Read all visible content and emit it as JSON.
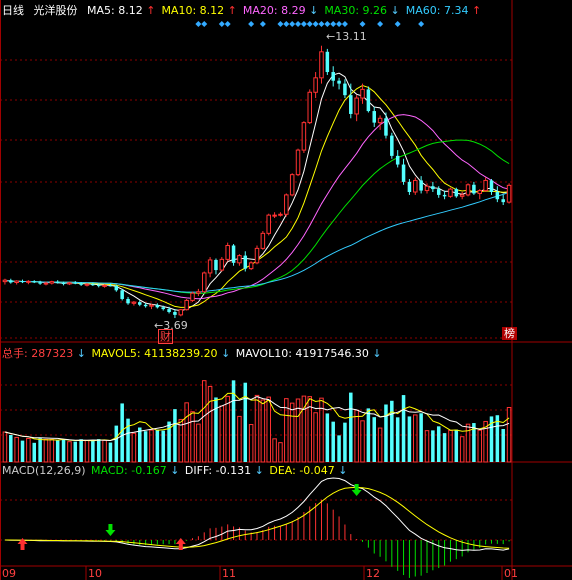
{
  "header": {
    "period": "日线",
    "stock_name": "光洋股份",
    "ma": [
      {
        "label": "MA5:",
        "value": "8.12",
        "arrow": "up",
        "color": "#ffffff"
      },
      {
        "label": "MA10:",
        "value": "8.12",
        "arrow": "up",
        "color": "#ffff00"
      },
      {
        "label": "MA20:",
        "value": "8.29",
        "arrow": "down",
        "color": "#ff66ff"
      },
      {
        "label": "MA30:",
        "value": "9.26",
        "arrow": "down",
        "color": "#00e000"
      },
      {
        "label": "MA60:",
        "value": "7.34",
        "arrow": "up",
        "color": "#33ccff"
      }
    ]
  },
  "volume_header": {
    "total_label": "总手:",
    "total_value": "287323",
    "vol5_label": "MAVOL5:",
    "vol5_value": "41138239.20",
    "vol10_label": "MAVOL10:",
    "vol10_value": "41917546.30"
  },
  "macd_header": {
    "name": "MACD(12,26,9)",
    "macd_label": "MACD:",
    "macd_value": "-0.167",
    "diff_label": "DIFF:",
    "diff_value": "-0.131",
    "dea_label": "DEA:",
    "dea_value": "-0.047"
  },
  "annotations": {
    "high_label": "13.11",
    "low_label": "3.69",
    "cai_tag": "财",
    "bang_tag": "榜"
  },
  "x_axis_labels": [
    "09",
    "10",
    "11",
    "12",
    "01"
  ],
  "colors": {
    "up": "#ff3232",
    "down": "#54ffff",
    "ma5": "#ffffff",
    "ma10": "#ffff00",
    "ma20": "#ff66ff",
    "ma30": "#00e000",
    "ma60": "#33ccff",
    "grid": "#8b0000",
    "axis_text": "#ff4040"
  },
  "chart_data": {
    "type": "candlestick",
    "period": "daily",
    "x_ticks": [
      "09",
      "10",
      "11",
      "12",
      "01"
    ],
    "price_range": [
      3.0,
      14.0
    ],
    "high_marker": 13.11,
    "low_marker": 3.69,
    "ohlc": [
      [
        4.95,
        5.05,
        4.85,
        5.0
      ],
      [
        5.0,
        5.05,
        4.88,
        4.92
      ],
      [
        4.92,
        5.0,
        4.85,
        4.97
      ],
      [
        4.97,
        5.02,
        4.9,
        4.93
      ],
      [
        4.93,
        5.0,
        4.86,
        4.96
      ],
      [
        4.96,
        5.0,
        4.9,
        4.92
      ],
      [
        4.92,
        4.98,
        4.84,
        4.88
      ],
      [
        4.88,
        4.95,
        4.82,
        4.9
      ],
      [
        4.9,
        4.98,
        4.85,
        4.95
      ],
      [
        4.95,
        5.0,
        4.88,
        4.9
      ],
      [
        4.9,
        4.95,
        4.82,
        4.87
      ],
      [
        4.87,
        4.94,
        4.83,
        4.91
      ],
      [
        4.91,
        4.97,
        4.86,
        4.89
      ],
      [
        4.89,
        4.93,
        4.8,
        4.84
      ],
      [
        4.84,
        4.9,
        4.78,
        4.86
      ],
      [
        4.86,
        4.92,
        4.8,
        4.83
      ],
      [
        4.83,
        4.88,
        4.75,
        4.8
      ],
      [
        4.8,
        4.86,
        4.74,
        4.82
      ],
      [
        4.82,
        4.88,
        4.78,
        4.8
      ],
      [
        4.8,
        4.84,
        4.6,
        4.65
      ],
      [
        4.65,
        4.7,
        4.3,
        4.35
      ],
      [
        4.35,
        4.42,
        4.15,
        4.2
      ],
      [
        4.2,
        4.28,
        4.12,
        4.24
      ],
      [
        4.24,
        4.3,
        4.1,
        4.15
      ],
      [
        4.15,
        4.22,
        4.05,
        4.1
      ],
      [
        4.1,
        4.18,
        4.0,
        4.14
      ],
      [
        4.14,
        4.2,
        4.02,
        4.06
      ],
      [
        4.06,
        4.12,
        3.95,
        4.0
      ],
      [
        4.0,
        4.08,
        3.85,
        3.9
      ],
      [
        3.9,
        4.0,
        3.69,
        3.8
      ],
      [
        3.8,
        4.0,
        3.75,
        3.98
      ],
      [
        3.98,
        4.35,
        3.95,
        4.3
      ],
      [
        4.3,
        4.6,
        4.25,
        4.55
      ],
      [
        4.55,
        4.7,
        4.45,
        4.6
      ],
      [
        4.6,
        5.3,
        4.6,
        5.25
      ],
      [
        5.25,
        5.8,
        5.1,
        5.7
      ],
      [
        5.7,
        5.75,
        5.2,
        5.35
      ],
      [
        5.35,
        5.8,
        5.3,
        5.72
      ],
      [
        5.72,
        6.3,
        5.65,
        6.2
      ],
      [
        6.2,
        6.25,
        5.5,
        5.6
      ],
      [
        5.6,
        5.9,
        5.5,
        5.85
      ],
      [
        5.85,
        6.0,
        5.3,
        5.4
      ],
      [
        5.4,
        5.65,
        5.35,
        5.6
      ],
      [
        5.6,
        6.2,
        5.55,
        6.1
      ],
      [
        6.1,
        6.7,
        6.05,
        6.62
      ],
      [
        6.62,
        7.3,
        6.55,
        7.25
      ],
      [
        7.25,
        7.35,
        7.15,
        7.25
      ],
      [
        7.25,
        7.35,
        7.2,
        7.28
      ],
      [
        7.28,
        8.0,
        7.2,
        7.95
      ],
      [
        7.95,
        8.7,
        7.9,
        8.65
      ],
      [
        8.65,
        9.55,
        8.6,
        9.5
      ],
      [
        9.5,
        10.5,
        9.4,
        10.45
      ],
      [
        10.45,
        11.6,
        10.4,
        11.5
      ],
      [
        11.5,
        12.2,
        11.3,
        12.0
      ],
      [
        12.0,
        13.11,
        11.8,
        12.9
      ],
      [
        12.9,
        13.0,
        12.1,
        12.2
      ],
      [
        12.2,
        12.4,
        11.7,
        11.9
      ],
      [
        11.9,
        12.0,
        11.6,
        11.8
      ],
      [
        11.8,
        11.95,
        11.3,
        11.4
      ],
      [
        11.4,
        11.8,
        10.6,
        10.75
      ],
      [
        10.75,
        11.4,
        10.5,
        11.3
      ],
      [
        11.3,
        11.8,
        11.1,
        11.6
      ],
      [
        11.6,
        11.7,
        10.8,
        10.85
      ],
      [
        10.85,
        11.0,
        10.3,
        10.45
      ],
      [
        10.45,
        10.7,
        10.2,
        10.6
      ],
      [
        10.6,
        10.8,
        9.9,
        10.0
      ],
      [
        10.0,
        10.1,
        9.2,
        9.3
      ],
      [
        9.3,
        9.5,
        8.9,
        9.0
      ],
      [
        9.0,
        9.2,
        8.3,
        8.4
      ],
      [
        8.4,
        8.5,
        7.95,
        8.05
      ],
      [
        8.05,
        8.55,
        7.95,
        8.45
      ],
      [
        8.45,
        8.6,
        8.0,
        8.1
      ],
      [
        8.1,
        8.35,
        8.0,
        8.25
      ],
      [
        8.25,
        8.4,
        8.05,
        8.15
      ],
      [
        8.15,
        8.25,
        7.85,
        7.95
      ],
      [
        7.95,
        8.1,
        7.8,
        7.9
      ],
      [
        7.9,
        8.2,
        7.85,
        8.15
      ],
      [
        8.15,
        8.2,
        7.85,
        7.9
      ],
      [
        7.9,
        8.05,
        7.8,
        7.95
      ],
      [
        7.95,
        8.35,
        7.9,
        8.3
      ],
      [
        8.3,
        8.4,
        7.95,
        8.0
      ],
      [
        8.0,
        8.15,
        7.8,
        8.1
      ],
      [
        8.1,
        8.55,
        8.05,
        8.45
      ],
      [
        8.45,
        8.5,
        7.95,
        8.05
      ],
      [
        8.05,
        8.25,
        7.7,
        7.8
      ],
      [
        7.8,
        7.95,
        7.6,
        7.7
      ],
      [
        7.7,
        8.35,
        7.65,
        8.28
      ]
    ],
    "ma_series": [
      {
        "name": "MA5",
        "last": 8.12
      },
      {
        "name": "MA10",
        "last": 8.12
      },
      {
        "name": "MA20",
        "last": 8.29
      },
      {
        "name": "MA30",
        "last": 9.26
      },
      {
        "name": "MA60",
        "last": 7.34
      }
    ],
    "volume": {
      "last_total": 287323,
      "mavol5": 41138239.2,
      "mavol10": 41917546.3
    },
    "macd": {
      "params": "12,26,9",
      "macd": -0.167,
      "diff": -0.131,
      "dea": -0.047
    }
  }
}
